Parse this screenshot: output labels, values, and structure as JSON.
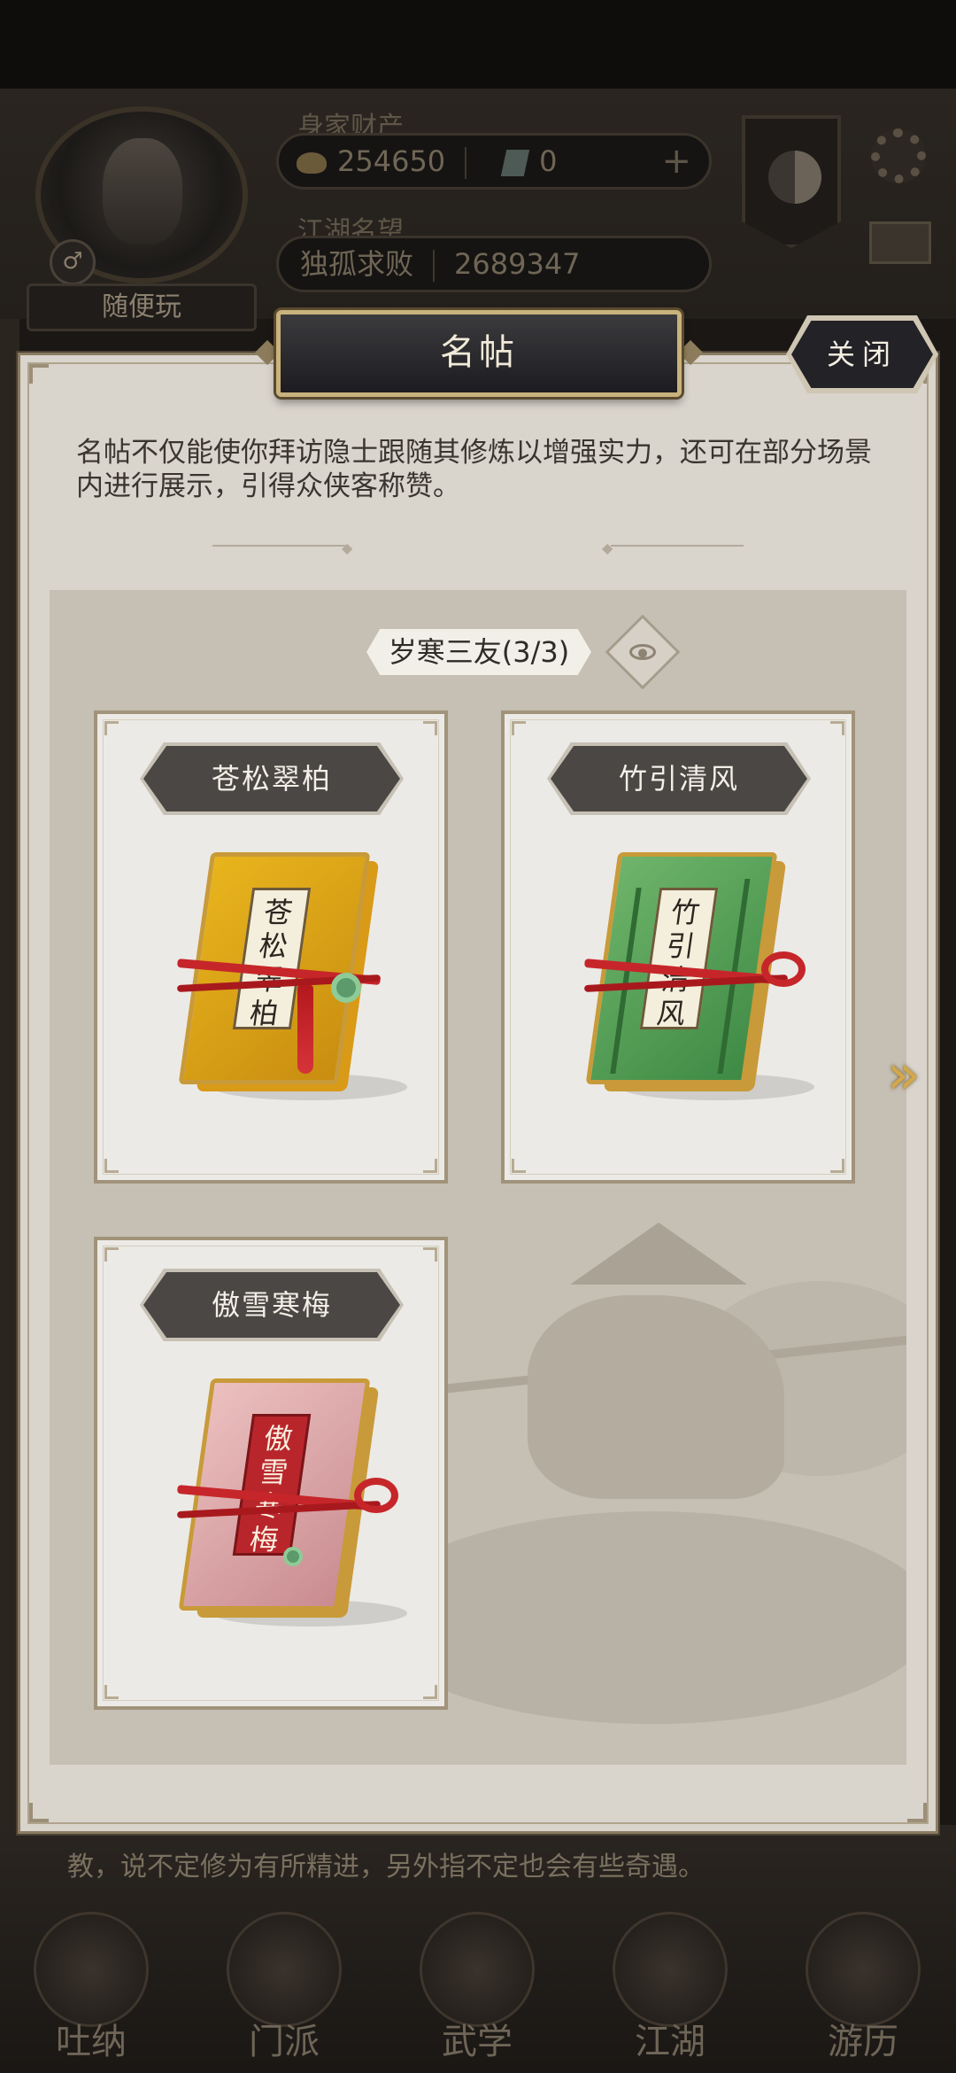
{
  "hud": {
    "assets_label": "身家财产",
    "coins": "254650",
    "jade": "0",
    "reputation_label": "江湖名望",
    "title": "独孤求败",
    "reputation": "2689347",
    "player_name": "随便玩",
    "gender_symbol": "♂",
    "plus_symbol": "+"
  },
  "bottom_hint": "教，说不定修为有所精进，另外指不定也会有些奇遇。",
  "bottom_nav": [
    {
      "label": "吐纳"
    },
    {
      "label": "门派"
    },
    {
      "label": "武学"
    },
    {
      "label": "江湖"
    },
    {
      "label": "游历"
    }
  ],
  "modal": {
    "title": "名帖",
    "close_label": "关闭",
    "intro": "名帖不仅能使你拜访隐士跟随其修炼以增强实力，还可在部分场景内进行展示，引得众侠客称赞。",
    "series_label": "岁寒三友(3/3)",
    "next_arrow": "»",
    "cards": [
      {
        "name": "苍松翠柏",
        "plate": "苍松翠柏",
        "theme": "yellow"
      },
      {
        "name": "竹引清风",
        "plate": "竹引清风",
        "theme": "green"
      },
      {
        "name": "傲雪寒梅",
        "plate": "傲雪寒梅",
        "theme": "pink"
      }
    ]
  },
  "icons": {
    "coin": "coin-icon",
    "jade": "jade-icon",
    "eye": "eye-icon",
    "gear": "gear-icon",
    "mail": "mail-icon"
  },
  "colors": {
    "modal_bg": "#d9d4cc",
    "panel_bg": "#c5bfb4",
    "title_bg": "#1d1c20",
    "gold": "#c9b27c",
    "arrow": "#d2a84a"
  }
}
